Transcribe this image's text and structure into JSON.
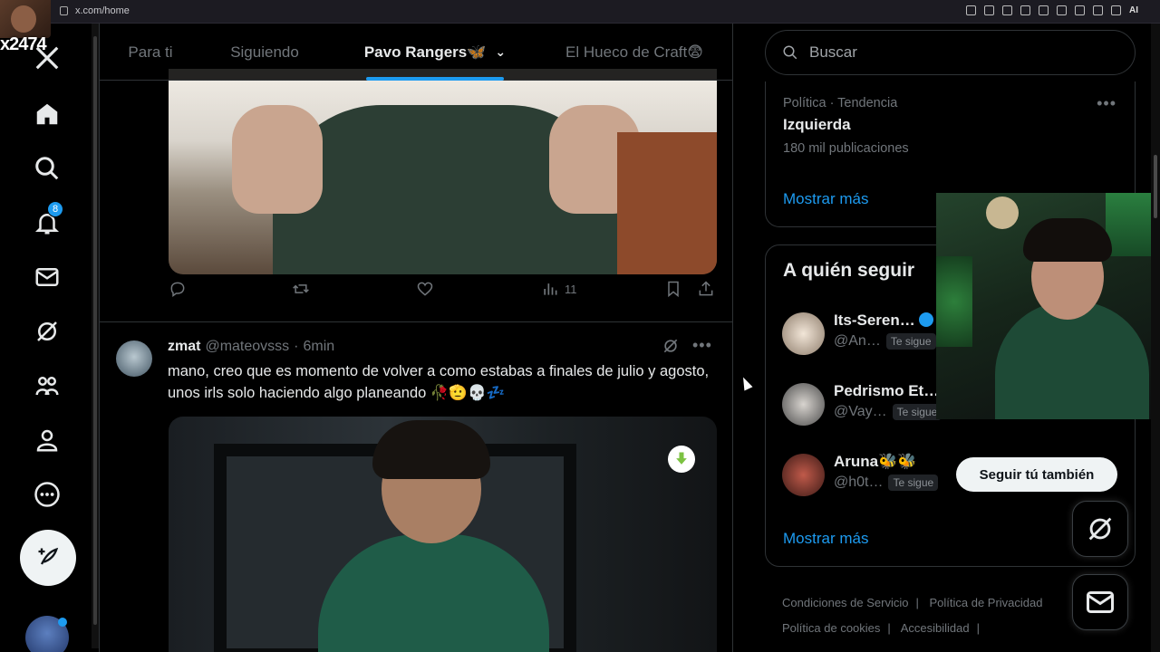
{
  "browser": {
    "url": "x.com/home",
    "ai_label": "AI"
  },
  "overlay": {
    "tag": "x2474"
  },
  "nav": {
    "notifications_badge": "8"
  },
  "tabs": [
    {
      "label": "Para ti",
      "active": false
    },
    {
      "label": "Siguiendo",
      "active": false
    },
    {
      "label": "Pavo Rangers🦋",
      "active": true
    },
    {
      "label": "El Hueco de Craft😨",
      "active": false
    }
  ],
  "post1": {
    "views": "11"
  },
  "post2": {
    "name": "zmat",
    "handle": "@mateovsss",
    "separator": "·",
    "time": "6min",
    "text": "mano, creo que es momento de volver a como estabas a finales de julio y agosto, unos irls solo haciendo algo planeando 🥀🫡💀💤"
  },
  "search": {
    "placeholder": "Buscar"
  },
  "trend": {
    "meta": "Política · Tendencia",
    "name": "Izquierda",
    "count": "180 mil publicaciones",
    "more": "Mostrar más"
  },
  "who_to_follow": {
    "title": "A quién seguir",
    "users": [
      {
        "name": "Its-Seren…",
        "handle": "@An…",
        "tag": "Te sigue",
        "verified": true
      },
      {
        "name": "Pedrismo Et…",
        "handle": "@Vay…",
        "tag": "Te sigue",
        "verified": false
      },
      {
        "name": "Aruna🐝🐝",
        "handle": "@h0t…",
        "tag": "Te sigue",
        "verified": false
      }
    ],
    "follow_button": "Seguir tú también",
    "more": "Mostrar más"
  },
  "footer": {
    "terms": "Condiciones de Servicio",
    "privacy": "Política de Privacidad",
    "cookies": "Política de cookies",
    "accessibility": "Accesibilidad"
  },
  "colors": {
    "accent": "#1d9bf0",
    "background": "#000000",
    "border": "#2f3336",
    "muted": "#71767b"
  }
}
